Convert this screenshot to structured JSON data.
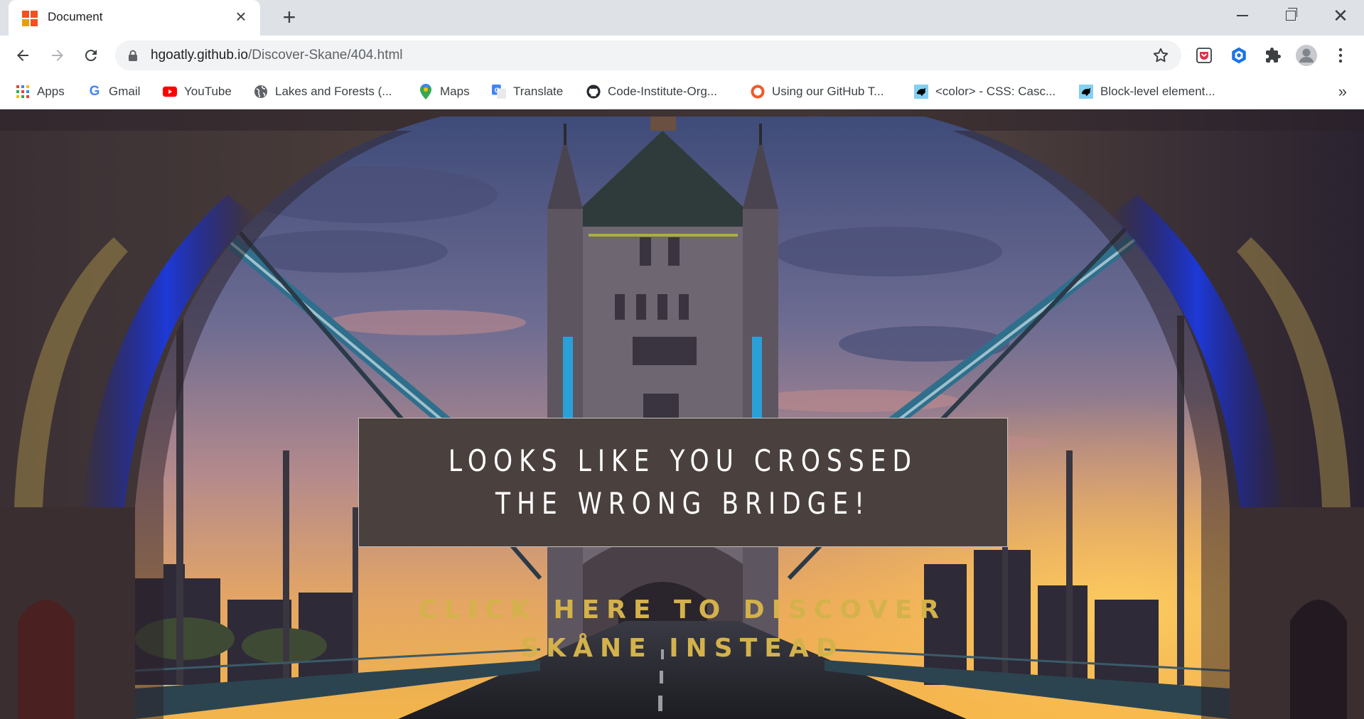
{
  "browser": {
    "tab": {
      "title": "Document",
      "favicon": "windows-logo-icon"
    },
    "address": {
      "host": "hgoatly.github.io",
      "path": "/Discover-Skane/404.html"
    },
    "bookmarks": [
      {
        "label": "Apps",
        "icon": "apps-grid-icon"
      },
      {
        "label": "Gmail",
        "icon": "google-icon"
      },
      {
        "label": "YouTube",
        "icon": "youtube-icon"
      },
      {
        "label": "Lakes and Forests (...",
        "icon": "globe-icon"
      },
      {
        "label": "Maps",
        "icon": "maps-pin-icon"
      },
      {
        "label": "Translate",
        "icon": "translate-icon"
      },
      {
        "label": "Code-Institute-Org...",
        "icon": "github-icon"
      },
      {
        "label": "Using our GitHub T...",
        "icon": "ring-icon"
      },
      {
        "label": "<color> - CSS: Casc...",
        "icon": "mdn-icon"
      },
      {
        "label": "Block-level element...",
        "icon": "mdn-icon"
      }
    ],
    "bookmarks_overflow": "»"
  },
  "page": {
    "heading": "Looks like you crossed the wrong bridge!",
    "cta": "Click here to discover Skåne instead"
  },
  "colors": {
    "message_box": "#4a403d",
    "cta_text": "#d4b24b"
  }
}
